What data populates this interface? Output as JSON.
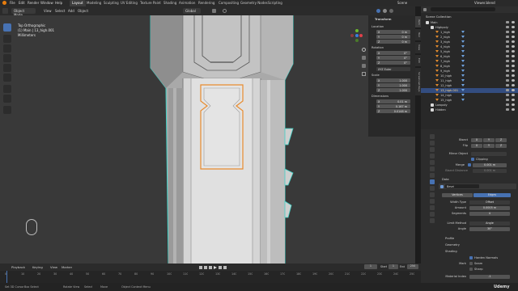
{
  "topbar": {
    "menus": [
      "File",
      "Edit",
      "Render",
      "Window",
      "Help"
    ],
    "workspaces": [
      "Layout",
      "Modeling",
      "Sculpting",
      "UV Editing",
      "Texture Paint",
      "Shading",
      "Animation",
      "Rendering",
      "Compositing",
      "Geometry Nodes",
      "Scripting"
    ],
    "active_workspace": "Layout",
    "file_title": "Viewer.blend",
    "scene_label": "Scene"
  },
  "viewport_header": {
    "mode": "Object Mode",
    "menus": [
      "View",
      "Select",
      "Add",
      "Object"
    ],
    "transform_orientation": "Global",
    "options_label": "Options"
  },
  "viewport": {
    "view_name": "Top Orthographic",
    "collection_info": "(1) Main | 13_high.001",
    "scale_info": "Millimeters"
  },
  "npanel": {
    "section": "Transform",
    "location_label": "Location",
    "location": [
      {
        "axis": "X",
        "value": "0 m"
      },
      {
        "axis": "Y",
        "value": "0 m"
      },
      {
        "axis": "Z",
        "value": "0 m"
      }
    ],
    "rotation_label": "Rotation",
    "rotation": [
      {
        "axis": "X",
        "value": "0°"
      },
      {
        "axis": "Y",
        "value": "0°"
      },
      {
        "axis": "Z",
        "value": "0°"
      }
    ],
    "rotation_mode": "XYZ Euler",
    "scale_label": "Scale",
    "scale": [
      {
        "axis": "X",
        "value": "1.000"
      },
      {
        "axis": "Y",
        "value": "1.000"
      },
      {
        "axis": "Z",
        "value": "1.000"
      }
    ],
    "dimensions_label": "Dimensions",
    "dimensions": [
      {
        "axis": "X",
        "value": "0.01 m"
      },
      {
        "axis": "Y",
        "value": "0.167 m"
      },
      {
        "axis": "Z",
        "value": "0.0148 m"
      }
    ],
    "tabs": [
      "Item",
      "Tool",
      "View",
      "Edit",
      "Screencast Keys"
    ]
  },
  "outliner": {
    "title": "Scene Collection",
    "filter_placeholder": "",
    "rows": [
      {
        "name": "Main",
        "indent": 0,
        "selected": false
      },
      {
        "name": "Highpoly",
        "indent": 1,
        "selected": false
      },
      {
        "name": "1_high",
        "indent": 2,
        "selected": false
      },
      {
        "name": "2_high",
        "indent": 2,
        "selected": false
      },
      {
        "name": "3_high",
        "indent": 2,
        "selected": false
      },
      {
        "name": "4_high",
        "indent": 2,
        "selected": false
      },
      {
        "name": "5_high",
        "indent": 2,
        "selected": false
      },
      {
        "name": "6_high",
        "indent": 2,
        "selected": false
      },
      {
        "name": "7_high",
        "indent": 2,
        "selected": false
      },
      {
        "name": "8_high",
        "indent": 2,
        "selected": false
      },
      {
        "name": "9_high",
        "indent": 2,
        "selected": false
      },
      {
        "name": "10_high",
        "indent": 2,
        "selected": false
      },
      {
        "name": "11_high",
        "indent": 2,
        "selected": false
      },
      {
        "name": "12_high",
        "indent": 2,
        "selected": false
      },
      {
        "name": "13_high.001",
        "indent": 2,
        "selected": true
      },
      {
        "name": "14_high",
        "indent": 2,
        "selected": false
      },
      {
        "name": "15_high",
        "indent": 2,
        "selected": false
      },
      {
        "name": "Lowpoly",
        "indent": 1,
        "selected": false
      },
      {
        "name": "Hidden",
        "indent": 1,
        "selected": false
      }
    ]
  },
  "properties": {
    "bevel_modifier": {
      "name": "Bevel",
      "mode_tabs": [
        "Vertices",
        "Edges"
      ],
      "active_mode": "Edges",
      "width_type_label": "Width Type",
      "width_type": "Offset",
      "amount_label": "Amount",
      "amount": "0.0005 m",
      "segments_label": "Segments",
      "segments": "4",
      "limit_method_label": "Limit Method",
      "limit_method": "Angle",
      "angle_label": "Angle",
      "angle": "30°",
      "profile_label": "Profile",
      "geometry_label": "Geometry",
      "shading_label": "Shading",
      "harden_normals_label": "Harden Normals",
      "mark_label": "Mark",
      "seam_label": "Seam",
      "sharp_label": "Sharp",
      "material_index_label": "Material Index",
      "material_index": "-1"
    },
    "mirror": {
      "bisect_label": "Bisect",
      "flip_label": "Flip",
      "mirror_object_label": "Mirror Object",
      "clipping_label": "Clipping",
      "merge_label": "Merge",
      "merge_value": "0.001 m",
      "bisect_distance_label": "Bisect Distance",
      "bisect_distance": "0.001 m",
      "axes": [
        "X",
        "Y",
        "Z"
      ]
    },
    "data_label": "Data"
  },
  "timeline": {
    "menus": [
      "Playback",
      "Keying",
      "View",
      "Marker"
    ],
    "ticks": [
      "0",
      "10",
      "20",
      "30",
      "40",
      "50",
      "60",
      "70",
      "80",
      "90",
      "100",
      "110",
      "120",
      "130",
      "140",
      "150",
      "160",
      "170",
      "180",
      "190",
      "200",
      "210",
      "220",
      "230",
      "240",
      "250"
    ],
    "current_frame": "1",
    "start_label": "Start",
    "start": "1",
    "end_label": "End",
    "end": "250"
  },
  "statusbar": {
    "items": [
      "Set 3D Cursor",
      "Box Select",
      "Rotate View",
      "Select",
      "Move",
      "Object Context Menu"
    ],
    "watermark": "Udemy"
  },
  "colors": {
    "accent": "#4772b3",
    "selection_outline": "#e88b2d",
    "object_edge": "#3fd3c7",
    "model_light": "#c9c9c9",
    "model_mid": "#a7a7a7",
    "model_dark": "#7d7d7d"
  }
}
